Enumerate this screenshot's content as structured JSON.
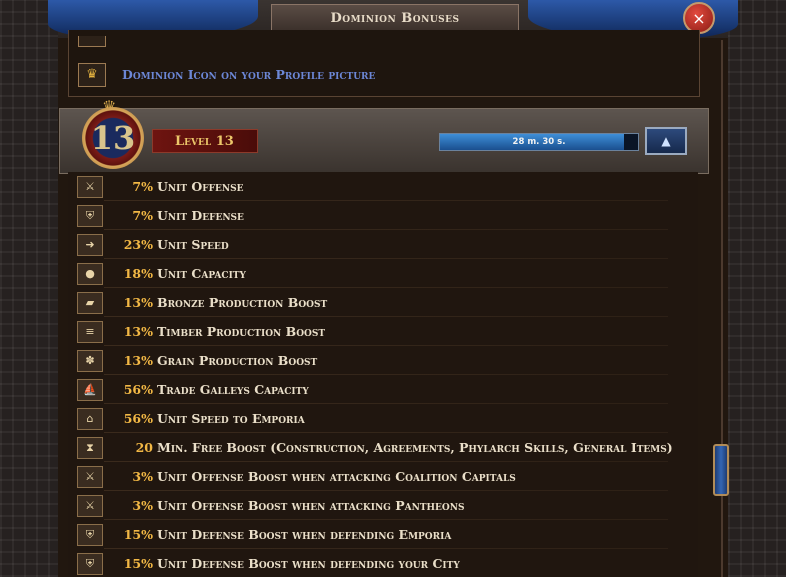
{
  "window": {
    "title": "Dominion Bonuses",
    "close_icon": "×"
  },
  "top_section": {
    "profile_row": {
      "icon": "crown-icon",
      "text": "Dominion Icon on your Profile picture"
    }
  },
  "level": {
    "number": "13",
    "label": "Level 13",
    "timer": "28 m. 30 s.",
    "progress_fraction": 0.93,
    "collapse_icon": "▲"
  },
  "bonuses": [
    {
      "icon": "swords-icon",
      "glyph": "⚔",
      "value": "7%",
      "label": "Unit Offense"
    },
    {
      "icon": "shield-icon",
      "glyph": "⛨",
      "value": "7%",
      "label": "Unit Defense"
    },
    {
      "icon": "helmet-icon",
      "glyph": "➜",
      "value": "23%",
      "label": "Unit Speed"
    },
    {
      "icon": "sack-icon",
      "glyph": "●",
      "value": "18%",
      "label": "Unit Capacity"
    },
    {
      "icon": "bronze-ingot-icon",
      "glyph": "▰",
      "value": "13%",
      "label": "Bronze Production Boost"
    },
    {
      "icon": "timber-icon",
      "glyph": "≡",
      "value": "13%",
      "label": "Timber Production Boost"
    },
    {
      "icon": "grain-icon",
      "glyph": "✽",
      "value": "13%",
      "label": "Grain Production Boost"
    },
    {
      "icon": "galley-icon",
      "glyph": "⛵",
      "value": "56%",
      "label": "Trade Galleys Capacity"
    },
    {
      "icon": "emporia-icon",
      "glyph": "⌂",
      "value": "56%",
      "label": "Unit Speed to Emporia"
    },
    {
      "icon": "hourglass-icon",
      "glyph": "⧗",
      "value": "20",
      "label": "Min. Free Boost (Construction, Agreements, Phylarch Skills, General Items)"
    },
    {
      "icon": "coalition-attack-icon",
      "glyph": "⚔",
      "value": "3%",
      "label": "Unit Offense Boost when attacking Coalition Capitals"
    },
    {
      "icon": "pantheon-attack-icon",
      "glyph": "⚔",
      "value": "3%",
      "label": "Unit Offense Boost when attacking Pantheons"
    },
    {
      "icon": "emporia-defense-icon",
      "glyph": "⛨",
      "value": "15%",
      "label": "Unit Defense Boost when defending Emporia"
    },
    {
      "icon": "city-defense-icon",
      "glyph": "⛨",
      "value": "15%",
      "label": "Unit Defense Boost when defending your City"
    }
  ]
}
